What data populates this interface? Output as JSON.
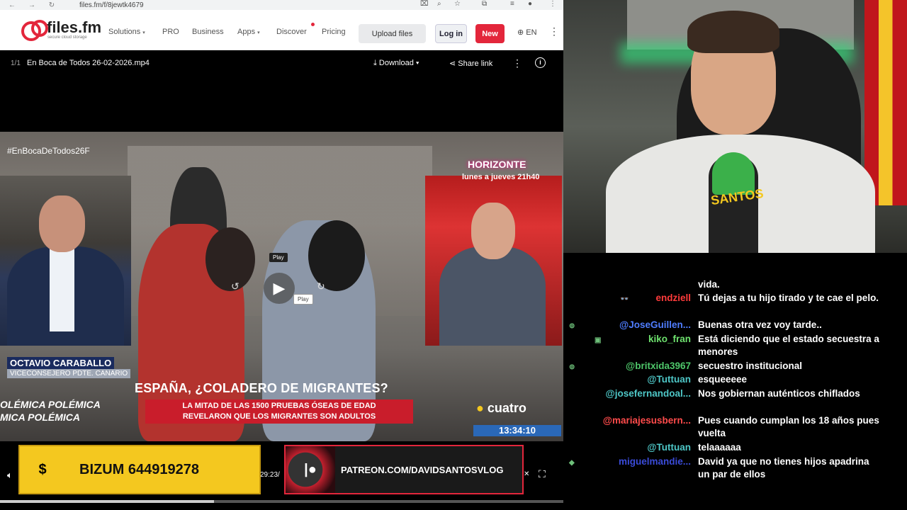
{
  "browser": {
    "url": "files.fm/f/8jewtk4679",
    "site": {
      "logo": "files.fm",
      "logo_sub": "secure cloud storage",
      "menu": [
        "Solutions",
        "PRO",
        "Business",
        "Apps",
        "Discover",
        "Pricing"
      ],
      "upload_label": "Upload files",
      "login_label": "Log in",
      "new_label": "New",
      "lang_label": "EN"
    },
    "file_bar": {
      "count": "1/1",
      "filename": "En Boca de Todos 26-02-2026.mp4",
      "download_label": "Download",
      "share_label": "Share link"
    }
  },
  "video": {
    "hashtag": "#EnBocaDeTodos26F",
    "guest_name": "OCTAVIO CARABALLO",
    "guest_role": "VICECONSEJERO PDTE. CANARIO",
    "headline": "ESPAÑA, ¿COLADERO DE MIGRANTES?",
    "subheadline_1": "LA MITAD DE LAS 1500 PRUEBAS ÓSEAS DE EDAD",
    "subheadline_2": "REVELARON QUE LOS MIGRANTES SON ADULTOS",
    "ticker_1": "OLÉMICA   POLÉMICA",
    "ticker_2": "MICA   POLÉMICA",
    "promo_title": "HORIZONTE",
    "promo_sub": "lunes a jueves 21h40",
    "channel": "cuatro",
    "clock": "13:34:10",
    "tooltip_top": "Play",
    "tooltip_bottom": "Play",
    "current_time": "29:23/",
    "progress_fraction": 0.38
  },
  "overlays": {
    "bizum": "BIZUM 644919278",
    "patreon": "PATREON.COM/DAVIDSANTOSVLOG"
  },
  "webcam": {
    "mic_label": "SANTOS"
  },
  "chat": {
    "messages": [
      {
        "user": "",
        "text": "vida.",
        "color": "#ffffff"
      },
      {
        "user": "endziell",
        "text": "Tú dejas a tu hijo tirado y te cae el pelo.",
        "color": "#ff3b3b"
      },
      {
        "user": "@JoseGuillen...",
        "text": "Buenas otra vez voy tarde..",
        "color": "#4f7dff"
      },
      {
        "user": "kiko_fran",
        "text": "Está diciendo que el estado secuestra a menores",
        "color": "#6ee26e"
      },
      {
        "user": "@britxida3967",
        "text": "secuestro institucional",
        "color": "#4ec76a"
      },
      {
        "user": "@Tuttuan",
        "text": "esqueeeee",
        "color": "#4ec7c7"
      },
      {
        "user": "@josefernandoal...",
        "text": "Nos gobiernan auténticos chiflados",
        "color": "#4ec7c7"
      },
      {
        "user": "@mariajesusbern...",
        "text": "Pues cuando cumplan los 18 años pues vuelta",
        "color": "#ff4b4b"
      },
      {
        "user": "@Tuttuan",
        "text": "telaaaaaa",
        "color": "#4ec7c7"
      },
      {
        "user": "miguelmandie...",
        "text": "David ya que no tienes hijos apadrina un par de ellos",
        "color": "#3a4bd8"
      }
    ]
  }
}
